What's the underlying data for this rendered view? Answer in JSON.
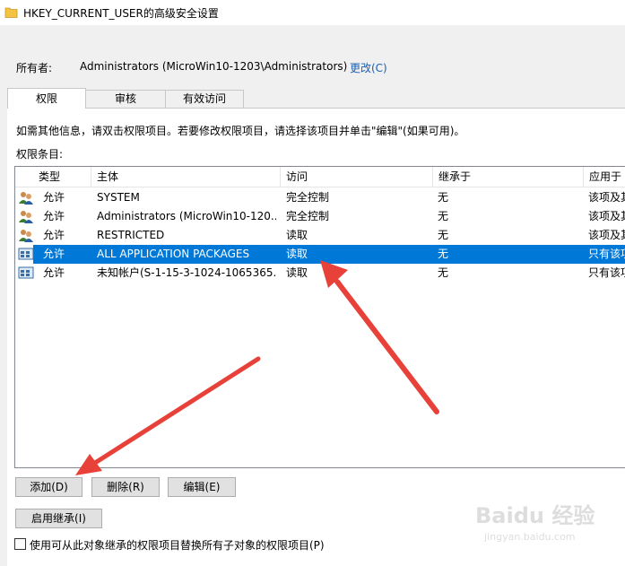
{
  "window": {
    "title": "HKEY_CURRENT_USER的高级安全设置"
  },
  "owner": {
    "label": "所有者:",
    "value": "Administrators (MicroWin10-1203\\Administrators)",
    "change_link": "更改(C)"
  },
  "tabs": [
    {
      "label": "权限",
      "active": true
    },
    {
      "label": "审核",
      "active": false
    },
    {
      "label": "有效访问",
      "active": false
    }
  ],
  "info_text": "如需其他信息，请双击权限项目。若要修改权限项目，请选择该项目并单击\"编辑\"(如果可用)。",
  "entries_label": "权限条目:",
  "table": {
    "columns": [
      "类型",
      "主体",
      "访问",
      "继承于",
      "应用于"
    ],
    "rows": [
      {
        "type": "允许",
        "principal": "SYSTEM",
        "access": "完全控制",
        "inherited": "无",
        "applies": "该项及其",
        "icon": "users-icon",
        "selected": false
      },
      {
        "type": "允许",
        "principal": "Administrators (MicroWin10-120...",
        "access": "完全控制",
        "inherited": "无",
        "applies": "该项及其",
        "icon": "users-icon",
        "selected": false
      },
      {
        "type": "允许",
        "principal": "RESTRICTED",
        "access": "读取",
        "inherited": "无",
        "applies": "该项及其",
        "icon": "users-icon",
        "selected": false
      },
      {
        "type": "允许",
        "principal": "ALL APPLICATION PACKAGES",
        "access": "读取",
        "inherited": "无",
        "applies": "只有该项",
        "icon": "package-icon",
        "selected": true
      },
      {
        "type": "允许",
        "principal": "未知帐户(S-1-15-3-1024-1065365...",
        "access": "读取",
        "inherited": "无",
        "applies": "只有该项",
        "icon": "package-icon",
        "selected": false
      }
    ]
  },
  "buttons": {
    "add": "添加(D)",
    "remove": "删除(R)",
    "edit": "编辑(E)",
    "enable_inheritance": "启用继承(I)"
  },
  "replace_checkbox": {
    "label": "使用可从此对象继承的权限项目替换所有子对象的权限项目(P)",
    "checked": false
  },
  "watermark": {
    "text": "Baidu 经验",
    "sub": "jingyan.baidu.com"
  },
  "colors": {
    "selection": "#0078d7",
    "link": "#1a5fb4",
    "arrow": "#e8413a"
  }
}
